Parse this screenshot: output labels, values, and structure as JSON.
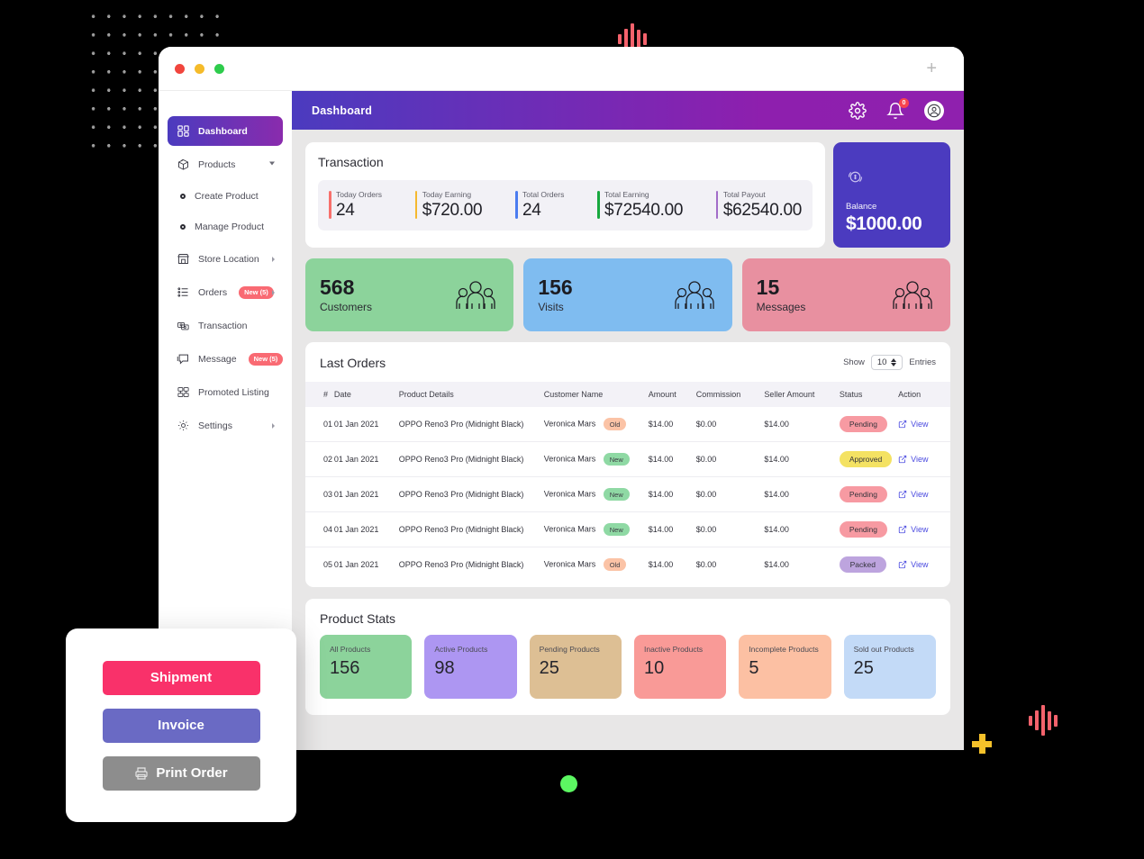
{
  "window": {
    "traffic_lights": [
      "close",
      "minimize",
      "maximize"
    ],
    "new_tab_label": "+"
  },
  "topbar": {
    "title": "Dashboard",
    "settings_icon": "gear-icon",
    "notification_icon": "bell-icon",
    "notification_count": "0",
    "avatar_icon": "user-avatar-icon"
  },
  "sidebar": {
    "items": [
      {
        "label": "Dashboard",
        "icon": "dashboard-grid-icon",
        "active": true,
        "badge": "",
        "caret": ""
      },
      {
        "label": "Products",
        "icon": "products-box-icon",
        "active": false,
        "badge": "",
        "caret": "down"
      },
      {
        "label": "Create Product",
        "icon": "bullet-icon",
        "sub": true
      },
      {
        "label": "Manage Product",
        "icon": "bullet-icon",
        "sub": true
      },
      {
        "label": "Store Location",
        "icon": "store-icon",
        "active": false,
        "badge": "",
        "caret": "right"
      },
      {
        "label": "Orders",
        "icon": "orders-list-icon",
        "active": false,
        "badge": "New (5)",
        "caret": "right"
      },
      {
        "label": "Transaction",
        "icon": "transaction-icon",
        "active": false,
        "badge": "",
        "caret": ""
      },
      {
        "label": "Message",
        "icon": "message-icon",
        "active": false,
        "badge": "New (5)",
        "caret": ""
      },
      {
        "label": "Promoted Listing",
        "icon": "promoted-listing-icon",
        "active": false,
        "badge": "",
        "caret": ""
      },
      {
        "label": "Settings",
        "icon": "settings-gear-icon",
        "active": false,
        "badge": "",
        "caret": "right"
      }
    ]
  },
  "transaction": {
    "title": "Transaction",
    "items": [
      {
        "label": "Today Orders",
        "value": "24",
        "color": "#f8706c"
      },
      {
        "label": "Today Earning",
        "value": "$720.00",
        "color": "#f5b82e"
      },
      {
        "label": "Total Orders",
        "value": "24",
        "color": "#4a7cf0"
      },
      {
        "label": "Total Earning",
        "value": "$72540.00",
        "color": "#18a83f"
      },
      {
        "label": "Total Payout",
        "value": "$62540.00",
        "color": "#a26cc9"
      }
    ]
  },
  "balance": {
    "icon": "coin-exchange-icon",
    "label": "Balance",
    "value": "$1000.00",
    "color": "#4b3bbf"
  },
  "stats": [
    {
      "number": "568",
      "label": "Customers",
      "color": "#8cd39b",
      "icon": "people-group-icon"
    },
    {
      "number": "156",
      "label": "Visits",
      "color": "#7fbcf0",
      "icon": "people-group-icon"
    },
    {
      "number": "15",
      "label": "Messages",
      "color": "#e890a0",
      "icon": "people-group-icon"
    }
  ],
  "orders": {
    "title": "Last Orders",
    "show_label": "Show",
    "entries_label": "Entries",
    "page_size": "10",
    "columns": [
      "#",
      "Date",
      "Product Details",
      "Customer Name",
      "Amount",
      "Commission",
      "Seller Amount",
      "Status",
      "Action"
    ],
    "rows": [
      {
        "n": "01",
        "date": "01 Jan 2021",
        "product": "OPPO Reno3 Pro (Midnight Black)",
        "customer": "Veronica Mars",
        "tag": "Old",
        "amount": "$14.00",
        "commission": "$0.00",
        "seller_amount": "$14.00",
        "status": "Pending",
        "action": "View"
      },
      {
        "n": "02",
        "date": "01 Jan 2021",
        "product": "OPPO Reno3 Pro (Midnight Black)",
        "customer": "Veronica Mars",
        "tag": "New",
        "amount": "$14.00",
        "commission": "$0.00",
        "seller_amount": "$14.00",
        "status": "Approved",
        "action": "View"
      },
      {
        "n": "03",
        "date": "01 Jan 2021",
        "product": "OPPO Reno3 Pro (Midnight Black)",
        "customer": "Veronica Mars",
        "tag": "New",
        "amount": "$14.00",
        "commission": "$0.00",
        "seller_amount": "$14.00",
        "status": "Pending",
        "action": "View"
      },
      {
        "n": "04",
        "date": "01 Jan 2021",
        "product": "OPPO Reno3 Pro (Midnight Black)",
        "customer": "Veronica Mars",
        "tag": "New",
        "amount": "$14.00",
        "commission": "$0.00",
        "seller_amount": "$14.00",
        "status": "Pending",
        "action": "View"
      },
      {
        "n": "05",
        "date": "01 Jan 2021",
        "product": "OPPO Reno3 Pro (Midnight Black)",
        "customer": "Veronica Mars",
        "tag": "Old",
        "amount": "$14.00",
        "commission": "$0.00",
        "seller_amount": "$14.00",
        "status": "Packed",
        "action": "View"
      }
    ]
  },
  "product_stats": {
    "title": "Product Stats",
    "boxes": [
      {
        "label": "All Products",
        "value": "156",
        "color": "#8cd39b"
      },
      {
        "label": "Active Products",
        "value": "98",
        "color": "#ad96f2"
      },
      {
        "label": "Pending Products",
        "value": "25",
        "color": "#ddbf94"
      },
      {
        "label": "Inactive Products",
        "value": "10",
        "color": "#f99a97"
      },
      {
        "label": "Incomplete Products",
        "value": "5",
        "color": "#fcc0a3"
      },
      {
        "label": "Sold out Products",
        "value": "25",
        "color": "#c3daf7"
      }
    ]
  },
  "action_card": {
    "buttons": [
      {
        "label": "Shipment",
        "color": "#f9316a",
        "icon": ""
      },
      {
        "label": "Invoice",
        "color": "#6a6ac4",
        "icon": ""
      },
      {
        "label": "Print Order",
        "color": "#8d8d8d",
        "icon": "printer-icon"
      }
    ]
  },
  "decorations": {
    "dot_grid_color": "#b9b9b9",
    "plus_color": "#f5c12a",
    "wave_color": "#f4626c",
    "green_dot_color": "#5cf762"
  }
}
